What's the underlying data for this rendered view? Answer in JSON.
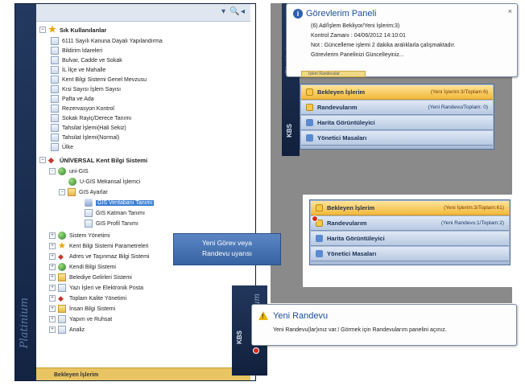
{
  "tree": {
    "brand": "Platinium",
    "toolbar": {
      "dropdown": "▾",
      "search": "🔍",
      "collapse": "◂"
    },
    "rows": [
      "Sık Kullanılanlar",
      "6111 Sayılı Kanuna Dayalı Yapılandırma",
      "Bildirim İdareleri",
      "Bulvar, Cadde ve Sokak",
      "İL İlçe ve Mahalle",
      "Kent Bilgi Sistemi Genel Mevzusu",
      "Kısi Sayısı İşlem Sayısı",
      "Pafta ve Ada",
      "Rezervasyon Kontrol",
      "Sokak Rayiç/Derece Tanımı",
      "Tahsilat İşlemi(Hali Sekiz)",
      "Tahsilat İşlemi(Normal)",
      "Ülke",
      "ÜNİVERSAL Kent Bilgi Sistemi",
      "uni-GIS",
      "U-GIS Mekansal İşlemci",
      "GIS Ayarlar",
      "GIS Veritabanı Tanımı",
      "GIS Katman Tanımı",
      "GIS Profil Tanımı",
      "Sistem Yönetimi",
      "Kent Bilgi Sistemi Parametreleri",
      "Adres ve Taşınmaz Bilgi Sistemi",
      "Kendi Bilgi Sistemi",
      "Belediye Gelirleri Sistemi",
      "Yazı İşleri ve Elektronik Posta",
      "Toplam Kalite Yönetimi",
      "İnsan Bilgi Sistemi",
      "Yapım ve Ruhsat",
      "Analiz"
    ],
    "bottom_bar": "Bekleyen İşlerim"
  },
  "callout": {
    "line1": "Yeni Görev veya",
    "line2": "Randevu uyarısı"
  },
  "gorevlerim_balloon": {
    "title": "Görevlerim Paneli",
    "close": "×",
    "lines": [
      "(6) Ad/İşlem Bekliyor/Yeni İşlerim:3)",
      "Kontrol Zamanı : 04/06/2012 14:10:01",
      "Not : Güncelleme işlemi 2 dakika aralıklarla çalışmaktadır.",
      "Görevlerim Panelinizi Güncelleyiniz..."
    ],
    "tab_hint": "İşlem Randevular"
  },
  "panel_top": {
    "rows": [
      {
        "label": "Bekleyen İşlerim",
        "count": "(Yeni İşlerim:3/Toplam:6)"
      },
      {
        "label": "Randevularım",
        "count": "(Yeni Randevu/Toplam: 0)"
      },
      {
        "label": "Harita Görüntüleyici",
        "count": ""
      },
      {
        "label": "Yönetici Masaları",
        "count": ""
      }
    ]
  },
  "panel_bottom": {
    "rows": [
      {
        "label": "Bekleyen İşlerim",
        "count": "(Yeni İşlerim:3/Toplam:61)"
      },
      {
        "label": "Randevularım",
        "count": "(Yeni Randevu:1/Toplam:2)"
      },
      {
        "label": "Harita Görüntüleyici",
        "count": ""
      },
      {
        "label": "Yönetici Masaları",
        "count": ""
      }
    ]
  },
  "strip_labels": {
    "kbs": "KBS",
    "brand": "Platinium"
  },
  "randevu_balloon": {
    "title": "Yeni Randevu",
    "text": "Yeni Randevu(lar)ınız var.! Görmek için Randevularım panelini açınız."
  }
}
